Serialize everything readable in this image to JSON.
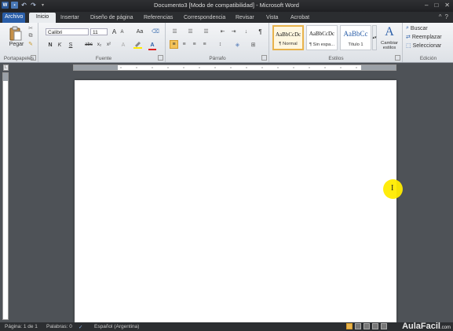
{
  "window": {
    "title": "Documento3 [Modo de compatibilidad] - Microsoft Word",
    "word_logo": "W",
    "quick_access": [
      "save-icon",
      "undo-icon",
      "redo-icon",
      "customize-icon"
    ],
    "controls": {
      "minimize": "–",
      "maximize": "□",
      "close": "✕"
    }
  },
  "tabs": {
    "file": "Archivo",
    "items": [
      "Inicio",
      "Insertar",
      "Diseño de página",
      "Referencias",
      "Correspondencia",
      "Revisar",
      "Vista",
      "Acrobat"
    ],
    "active": "Inicio"
  },
  "ribbon": {
    "clipboard": {
      "label": "Portapapeles",
      "paste": "Pegar"
    },
    "font": {
      "label": "Fuente",
      "font_name": "Calibri",
      "font_size": "11",
      "grow": "A",
      "shrink": "A",
      "case": "Aa",
      "bold": "N",
      "italic": "K",
      "underline": "S",
      "strike": "abc",
      "subscript": "x₂",
      "superscript": "x²",
      "font_color": "A"
    },
    "paragraph": {
      "label": "Párrafo",
      "pilcrow": "¶"
    },
    "styles": {
      "label": "Estilos",
      "items": [
        {
          "sample": "AaBbCcDc",
          "name": "¶ Normal"
        },
        {
          "sample": "AaBbCcDc",
          "name": "¶ Sin espa..."
        },
        {
          "sample": "AaBbCc",
          "name": "Título 1"
        }
      ],
      "change": "Cambiar estilos"
    },
    "editing": {
      "label": "Edición",
      "find": "Buscar",
      "replace": "Reemplazar",
      "select": "Seleccionar"
    }
  },
  "ruler": {
    "corner": "L"
  },
  "status": {
    "page": "Página: 1 de 1",
    "words": "Palabras: 0",
    "language": "Español (Argentina)",
    "watermark": "AulaFacil",
    "watermark_suffix": ".com"
  },
  "colors": {
    "accent": "#2a5ea8",
    "highlight": "#ffeb00"
  }
}
